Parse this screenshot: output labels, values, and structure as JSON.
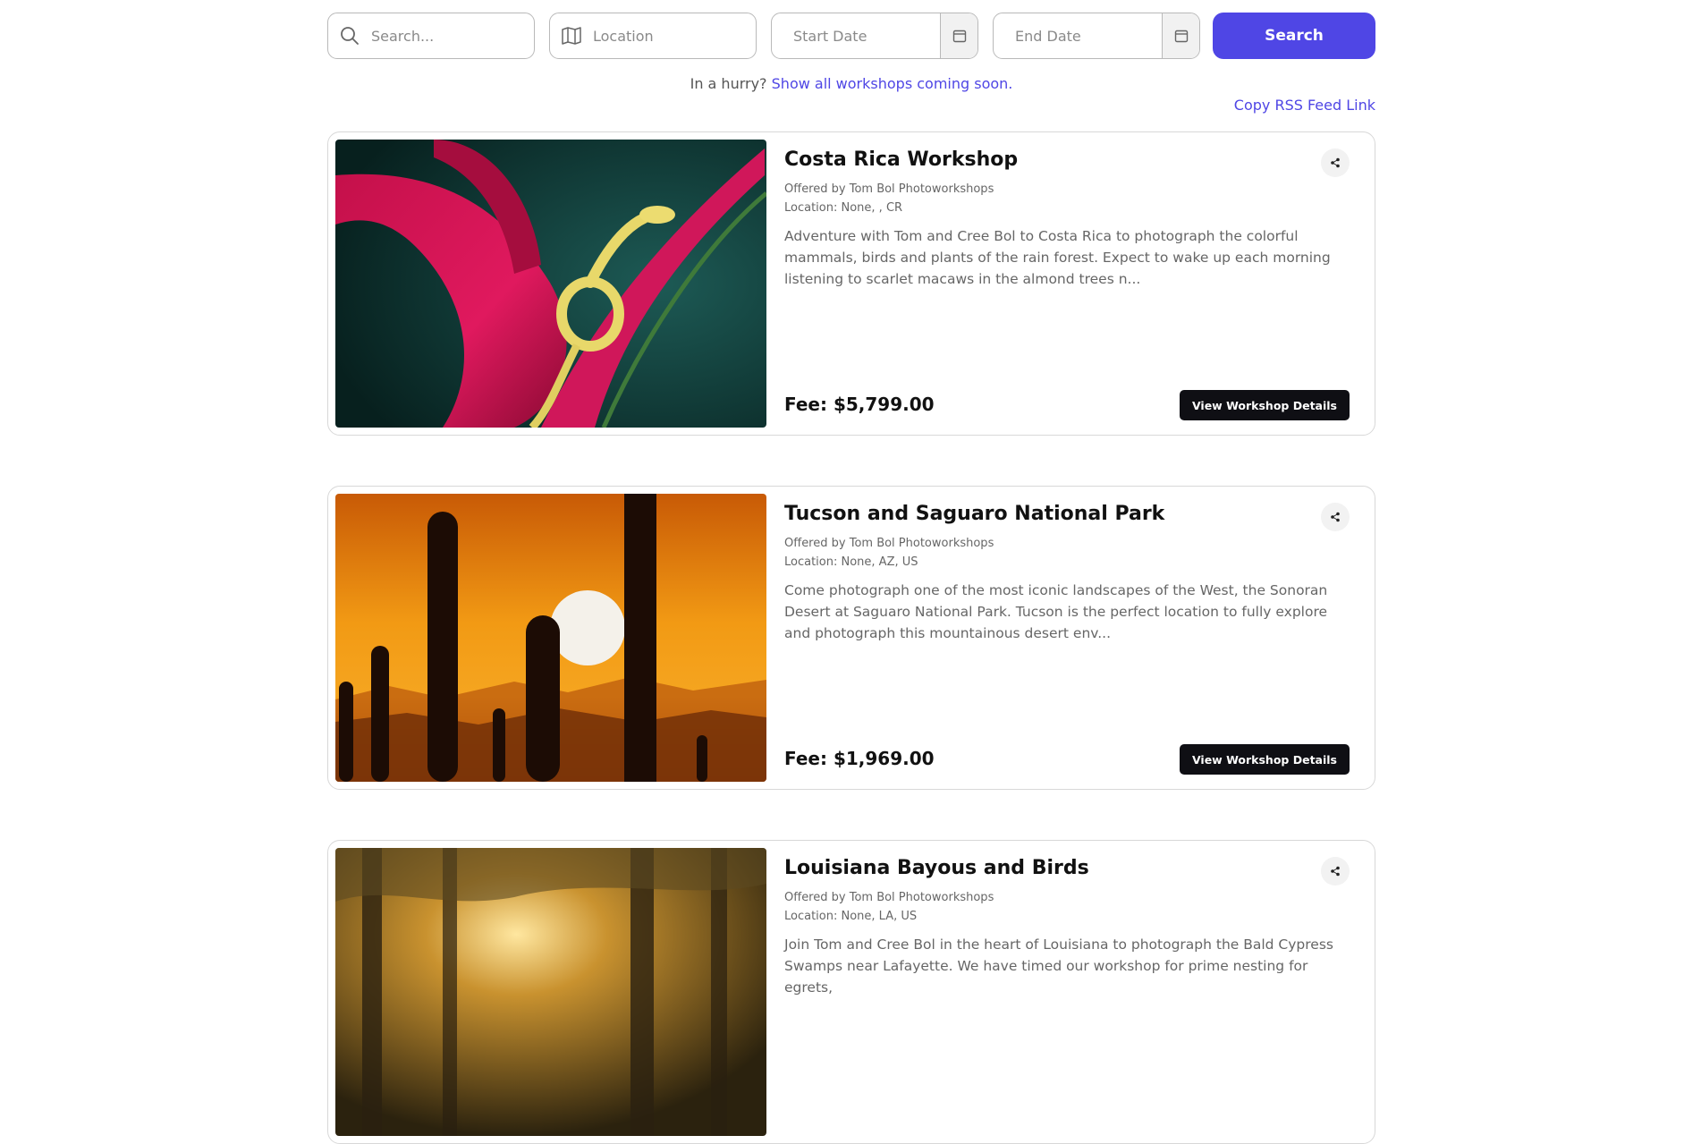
{
  "search": {
    "keyword_placeholder": "Search...",
    "location_placeholder": "Location",
    "start_date_placeholder": "Start Date",
    "end_date_placeholder": "End Date",
    "button_label": "Search"
  },
  "hurry": {
    "prefix": "In a hurry?",
    "link": "Show all workshops coming soon."
  },
  "rss_link": "Copy RSS Feed Link",
  "colors": {
    "accent": "#4f46e5",
    "dark_button": "#0f0f14"
  },
  "workshops": [
    {
      "title": "Costa Rica Workshop",
      "offered_by": "Offered by Tom Bol Photoworkshops",
      "location": "Location: None, , CR",
      "description": "Adventure with Tom and Cree Bol to Costa Rica to photograph the colorful mammals, birds and plants of the rain forest. Expect to wake up each morning listening to scarlet macaws in the almond trees n...",
      "fee": "Fee: $5,799.00",
      "button": "View Workshop Details",
      "share_icon": "share-icon"
    },
    {
      "title": "Tucson and Saguaro National Park",
      "offered_by": "Offered by Tom Bol Photoworkshops",
      "location": "Location: None, AZ, US",
      "description": "Come photograph one of the most iconic landscapes of the West, the Sonoran Desert at Saguaro National Park. Tucson is the perfect location to fully explore and photograph this mountainous desert env...",
      "fee": "Fee: $1,969.00",
      "button": "View Workshop Details",
      "share_icon": "share-icon"
    },
    {
      "title": "Louisiana Bayous and Birds",
      "offered_by": "Offered by Tom Bol Photoworkshops",
      "location": "Location: None, LA, US",
      "description": "Join Tom and Cree Bol in the heart of Louisiana to photograph the Bald Cypress Swamps near Lafayette. We have timed our workshop for prime nesting for egrets,",
      "share_icon": "share-icon"
    }
  ]
}
